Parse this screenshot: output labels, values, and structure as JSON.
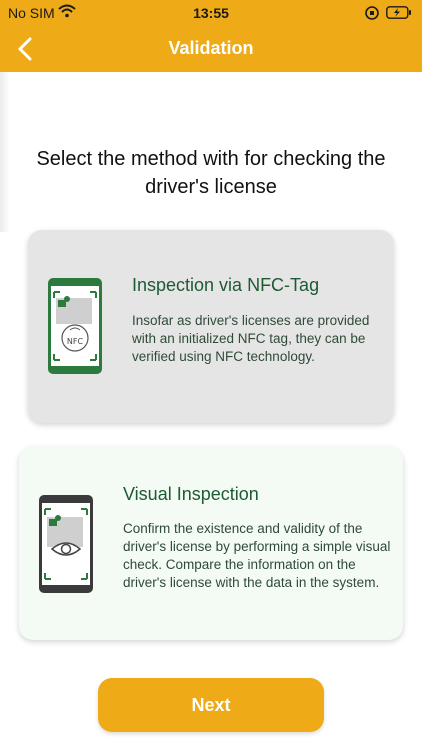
{
  "status_bar": {
    "carrier": "No SIM",
    "time": "13:55"
  },
  "nav": {
    "title": "Validation",
    "back_icon": "chevron-left-icon"
  },
  "heading": "Select the method with for checking the driver's license",
  "options": [
    {
      "title": "Inspection via NFC-Tag",
      "description": "Insofar as driver's licenses are provided with an initialized NFC tag, they can be verified using NFC technology.",
      "icon": "nfc-phone-icon",
      "icon_label": "NFC",
      "selected": false
    },
    {
      "title": "Visual Inspection",
      "description": "Confirm the existence and validity of the driver's license by performing a simple visual check. Compare the information on the driver's license with the data in the system.",
      "icon": "visual-inspection-phone-icon",
      "selected": true
    }
  ],
  "next_button": {
    "label": "Next"
  },
  "colors": {
    "accent": "#EEAA17",
    "card_green": "#1E5A33",
    "selected_bg": "#F3FBF4",
    "unselected_bg": "#E5E5E5"
  }
}
